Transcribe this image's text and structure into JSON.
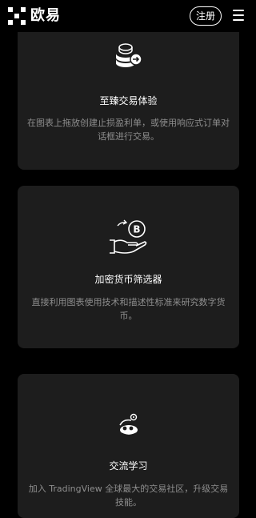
{
  "header": {
    "brand": "欧易",
    "signup_label": "注册"
  },
  "cards": [
    {
      "icon": "coins-arrow-icon",
      "title": "至臻交易体验",
      "description": "在图表上拖放创建止损盈利单，或使用响应式订单对话框进行交易。"
    },
    {
      "icon": "hand-bitcoin-icon",
      "title": "加密货币筛选器",
      "description": "直接利用图表使用技术和描述性标准来研究数字货币。"
    },
    {
      "icon": "community-icon",
      "title": "交流学习",
      "description": "加入 TradingView 全球最大的交易社区，升级交易技能。"
    }
  ],
  "colors": {
    "background": "#000000",
    "card": "#1d1d1d",
    "text": "#ffffff",
    "muted": "#8e8e8e"
  }
}
